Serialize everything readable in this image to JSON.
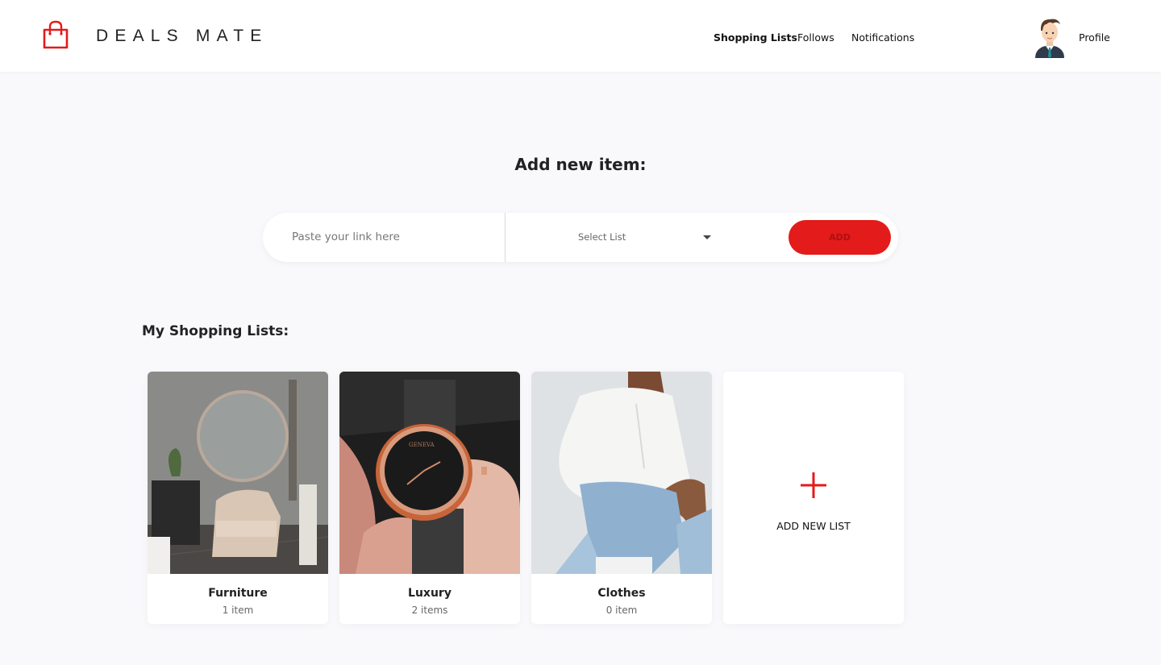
{
  "header": {
    "brand": "DEALS MATE",
    "logo_icon": "shopping-bag-icon",
    "nav": {
      "shopping_lists": "Shopping Lists",
      "follows": "Follows",
      "notifications": "Notifications"
    },
    "profile": "Profile",
    "accent_color": "#e31b1b"
  },
  "add_item": {
    "title": "Add new item:",
    "link_placeholder": "Paste your link here",
    "link_value": "",
    "select_label": "Select List",
    "add_button": "ADD"
  },
  "lists": {
    "title": "My Shopping Lists:",
    "cards": [
      {
        "name": "Furniture",
        "count": "1 item"
      },
      {
        "name": "Luxury",
        "count": "2 items"
      },
      {
        "name": "Clothes",
        "count": "0 item"
      }
    ],
    "add_new_label": "ADD NEW LIST",
    "add_new_icon": "plus-icon"
  }
}
